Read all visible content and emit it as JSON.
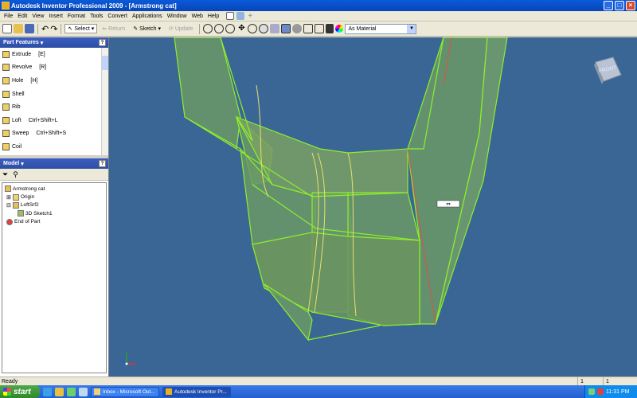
{
  "window": {
    "title": "Autodesk Inventor Professional 2009 - [Armstrong cat]"
  },
  "menu": [
    "File",
    "Edit",
    "View",
    "Insert",
    "Format",
    "Tools",
    "Convert",
    "Applications",
    "Window",
    "Web",
    "Help"
  ],
  "toolbar": {
    "select_label": "Select",
    "return_label": "Return",
    "sketch_label": "Sketch",
    "update_label": "Update",
    "material_value": "As Material"
  },
  "part_features": {
    "header": "Part Features",
    "items": [
      {
        "label": "Extrude",
        "shortcut": "[E]"
      },
      {
        "label": "Revolve",
        "shortcut": "[R]"
      },
      {
        "label": "Hole",
        "shortcut": "[H]"
      },
      {
        "label": "Shell",
        "shortcut": ""
      },
      {
        "label": "Rib",
        "shortcut": ""
      },
      {
        "label": "Loft",
        "shortcut": "Ctrl+Shift+L"
      },
      {
        "label": "Sweep",
        "shortcut": "Ctrl+Shift+S"
      },
      {
        "label": "Coil",
        "shortcut": ""
      }
    ]
  },
  "model": {
    "header": "Model",
    "tree": [
      {
        "label": "Armstrong cat",
        "depth": 0
      },
      {
        "label": "Origin",
        "depth": 1
      },
      {
        "label": "LoftSrf2",
        "depth": 1
      },
      {
        "label": "3D Sketch1",
        "depth": 2
      },
      {
        "label": "End of Part",
        "depth": 1
      }
    ]
  },
  "viewcube": {
    "label": "FRONT"
  },
  "status": {
    "text": "Ready",
    "cell1": "1",
    "cell2": "1"
  },
  "taskbar": {
    "start_label": "start",
    "tasks": [
      "Inbox - Microsoft Out...",
      "Autodesk Inventor Pr..."
    ],
    "clock": "11:31 PM"
  },
  "colors": {
    "viewport_bg": "#3a6695",
    "surface_fill": "#6b9966",
    "surface_edge": "#8ef02a",
    "seam_edge": "#e0504a"
  }
}
